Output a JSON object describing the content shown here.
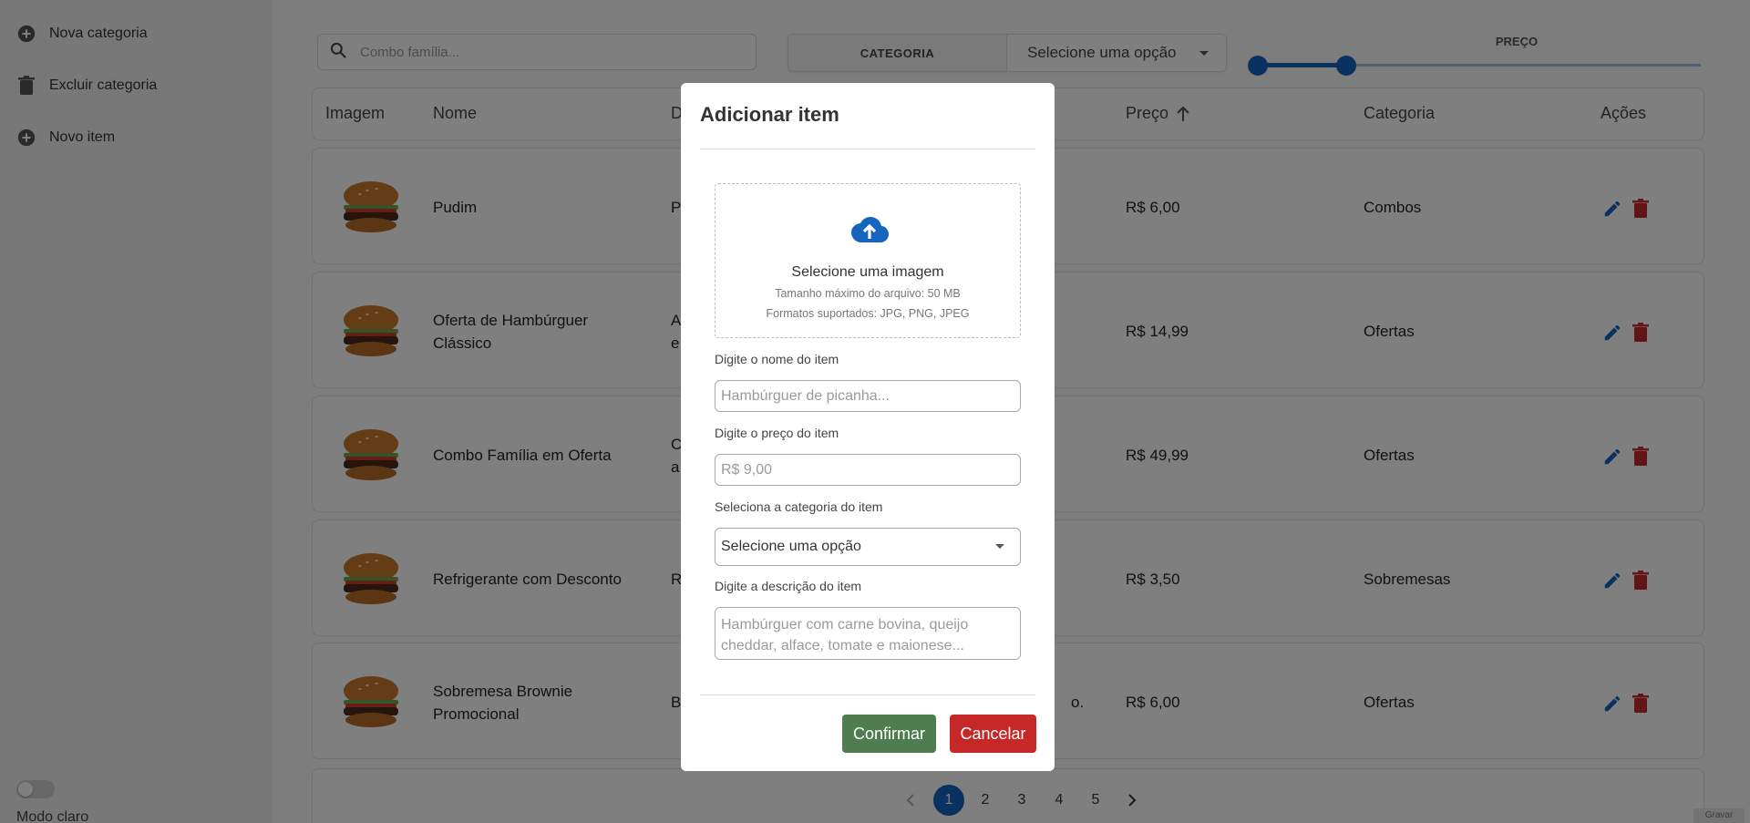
{
  "sidebar": {
    "items": [
      {
        "label": "Nova categoria",
        "icon": "add-circle-icon"
      },
      {
        "label": "Excluir categoria",
        "icon": "trash-icon"
      },
      {
        "label": "Novo item",
        "icon": "add-circle-icon"
      }
    ],
    "theme_label": "Modo claro"
  },
  "toolbar": {
    "search_placeholder": "Combo família...",
    "filter_category_label": "CATEGORIA",
    "filter_select_value": "Selecione uma opção",
    "price_label": "PREÇO"
  },
  "table": {
    "headers": [
      "Imagem",
      "Nome",
      "D",
      "Preço",
      "Categoria",
      "Ações"
    ],
    "rows": [
      {
        "name_lines": [
          "Pudim",
          ""
        ],
        "desc_lines": [
          "P",
          ""
        ],
        "price": "R$ 6,00",
        "category": "Combos"
      },
      {
        "name_lines": [
          "Oferta de Hambúrguer",
          "Clássico"
        ],
        "desc_lines": [
          "A",
          "e"
        ],
        "price": "R$ 14,99",
        "category": "Ofertas"
      },
      {
        "name_lines": [
          "Combo Família em Oferta",
          ""
        ],
        "desc_lines": [
          "C",
          "a"
        ],
        "price": "R$ 49,99",
        "category": "Ofertas"
      },
      {
        "name_lines": [
          "Refrigerante com Desconto",
          ""
        ],
        "desc_lines": [
          "R",
          ""
        ],
        "price": "R$ 3,50",
        "category": "Sobremesas"
      },
      {
        "name_lines": [
          "Sobremesa Brownie",
          "Promocional"
        ],
        "desc_lines": [
          "B",
          ""
        ],
        "desc_tail": "o.",
        "price": "R$ 6,00",
        "category": "Ofertas"
      }
    ]
  },
  "pagination": {
    "pages": [
      "1",
      "2",
      "3",
      "4",
      "5"
    ],
    "current": "1",
    "prev_icon": "chevron-left-icon",
    "next_icon": "chevron-right-icon"
  },
  "record_badge": "Gravar",
  "modal": {
    "title": "Adicionar item",
    "upload": {
      "icon": "cloud-upload-icon",
      "title": "Selecione uma imagem",
      "max_size": "Tamanho máximo do arquivo: 50 MB",
      "formats": "Formatos suportados: JPG, PNG, JPEG"
    },
    "name_label": "Digite o nome do item",
    "name_placeholder": "Hambúrguer de picanha...",
    "price_label": "Digite o preço do item",
    "price_placeholder": "R$ 9,00",
    "category_label": "Seleciona a categoria do item",
    "category_value": "Selecione uma opção",
    "desc_label": "Digite a descrição do item",
    "desc_placeholder": "Hambúrguer com carne bovina, queijo cheddar, alface, tomate e maionese...",
    "confirm_label": "Confirmar",
    "cancel_label": "Cancelar"
  },
  "colors": {
    "accent": "#1565c0",
    "confirm": "#4f7d50",
    "cancel": "#c62828",
    "delete_icon": "#c62828",
    "edit_icon": "#1565c0"
  }
}
